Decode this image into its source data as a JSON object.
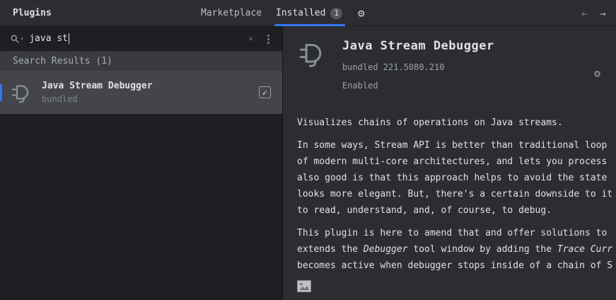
{
  "header": {
    "title": "Plugins",
    "tabs": [
      {
        "label": "Marketplace"
      },
      {
        "label": "Installed",
        "badge": "1"
      }
    ]
  },
  "search": {
    "value": "java st",
    "results_header": "Search Results (1)"
  },
  "results": [
    {
      "title": "Java Stream Debugger",
      "subtitle": "bundled",
      "enabled": true
    }
  ],
  "details": {
    "title": "Java Stream Debugger",
    "meta": "bundled 221.5080.210",
    "status": "Enabled",
    "paragraphs": [
      {
        "lines": [
          [
            {
              "text": "Visualizes chains of operations on Java streams."
            }
          ]
        ]
      },
      {
        "lines": [
          [
            {
              "text": "In some ways, Stream API is better than traditional loop"
            }
          ],
          [
            {
              "text": "of modern multi-core architectures, and lets you process"
            }
          ],
          [
            {
              "text": "also good is that this approach helps to avoid the state"
            }
          ],
          [
            {
              "text": "looks more elegant. But, there's a certain downside to it"
            }
          ],
          [
            {
              "text": "to read, understand, and, of course, to debug."
            }
          ]
        ]
      },
      {
        "lines": [
          [
            {
              "text": "This plugin is here to amend that and offer solutions to"
            }
          ],
          [
            {
              "text": "extends the "
            },
            {
              "text": "Debugger",
              "italic": true
            },
            {
              "text": " tool window by adding the "
            },
            {
              "text": "Trace Curr",
              "italic": true
            }
          ],
          [
            {
              "text": "becomes active when debugger stops inside of a chain of S"
            }
          ]
        ]
      }
    ]
  },
  "colors": {
    "accent": "#3574f0",
    "panel_bg": "#2b2d30",
    "sidebar_bg": "#1e1f22",
    "selection_bg": "#43454a"
  }
}
